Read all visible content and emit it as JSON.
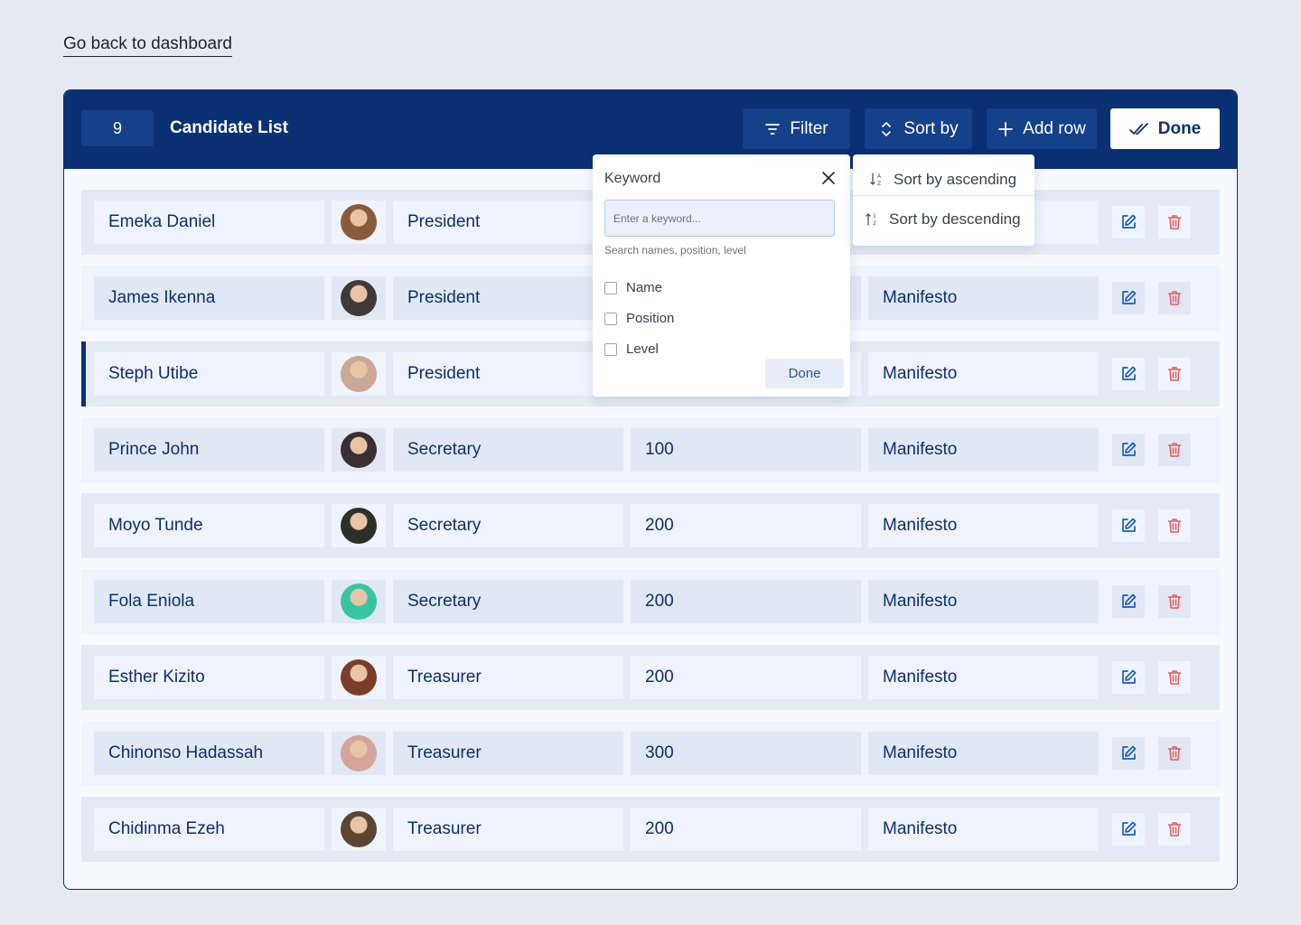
{
  "nav": {
    "back_label": "Go back to dashboard"
  },
  "header": {
    "count": "9",
    "title": "Candidate List",
    "filter_label": "Filter",
    "sort_label": "Sort by",
    "add_label": "Add row",
    "done_label": "Done"
  },
  "rows": [
    {
      "name": "Emeka Daniel",
      "position": "President",
      "level": "",
      "manifesto": "",
      "avatar_color": "#8a5a3b"
    },
    {
      "name": "James Ikenna",
      "position": "President",
      "level": "",
      "manifesto": "Manifesto",
      "avatar_color": "#3e3a38"
    },
    {
      "name": "Steph Utibe",
      "position": "President",
      "level": "",
      "manifesto": "Manifesto",
      "avatar_color": "#c9a995"
    },
    {
      "name": "Prince John",
      "position": "Secretary",
      "level": "100",
      "manifesto": "Manifesto",
      "avatar_color": "#3b2f36"
    },
    {
      "name": "Moyo Tunde",
      "position": "Secretary",
      "level": "200",
      "manifesto": "Manifesto",
      "avatar_color": "#2c3128"
    },
    {
      "name": "Fola Eniola",
      "position": "Secretary",
      "level": "200",
      "manifesto": "Manifesto",
      "avatar_color": "#36c6a3"
    },
    {
      "name": "Esther Kizito",
      "position": "Treasurer",
      "level": "200",
      "manifesto": "Manifesto",
      "avatar_color": "#7a3d2a"
    },
    {
      "name": "Chinonso Hadassah",
      "position": "Treasurer",
      "level": "300",
      "manifesto": "Manifesto",
      "avatar_color": "#d7a49a"
    },
    {
      "name": "Chidinma Ezeh",
      "position": "Treasurer",
      "level": "200",
      "manifesto": "Manifesto",
      "avatar_color": "#5b4631"
    }
  ],
  "filter_popover": {
    "title": "Keyword",
    "placeholder": "Enter a keyword...",
    "hint": "Search names, position, level",
    "options": [
      "Name",
      "Position",
      "Level"
    ],
    "done_label": "Done"
  },
  "sort_popover": {
    "ascending_label": "Sort by ascending",
    "descending_label": "Sort by descending"
  },
  "colors": {
    "brand": "#0a3174",
    "edit_icon": "#1f5bb8",
    "delete_icon": "#e45b5b"
  }
}
